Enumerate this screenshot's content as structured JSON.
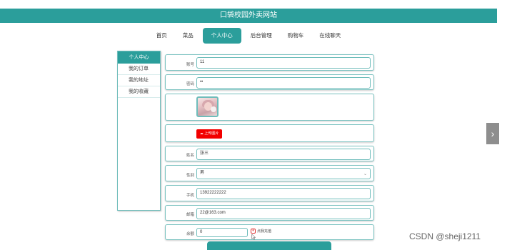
{
  "header": {
    "title": "口袋校园外卖网站"
  },
  "nav": [
    {
      "label": "首页",
      "active": false
    },
    {
      "label": "菜品",
      "active": false
    },
    {
      "label": "个人中心",
      "active": true
    },
    {
      "label": "后台管理",
      "active": false
    },
    {
      "label": "购物车",
      "active": false
    },
    {
      "label": "在线聊天",
      "active": false
    }
  ],
  "sidebar": {
    "title": "个人中心",
    "items": [
      "我的订单",
      "我的地址",
      "我的收藏"
    ]
  },
  "form": {
    "account": {
      "label": "账号",
      "value": "11"
    },
    "password": {
      "label": "密码",
      "value": "••"
    },
    "avatar": {
      "upload_label": "上传图片",
      "upload_icon": "cloud-upload-icon"
    },
    "name": {
      "label": "姓名",
      "value": "张三"
    },
    "gender": {
      "label": "性别",
      "value": "男"
    },
    "phone": {
      "label": "手机",
      "value": "13922222222"
    },
    "email": {
      "label": "邮箱",
      "value": "22@163.com"
    },
    "balance": {
      "label": "余额",
      "value": "0",
      "recharge_label": "点我充值"
    }
  },
  "side_nav": {
    "next_icon": "chevron-right-icon",
    "glyph": "›"
  },
  "watermark": "CSDN @sheji1211",
  "colors": {
    "primary": "#2b9e9b",
    "upload": "#f20000",
    "border": "#6fbdbb"
  }
}
